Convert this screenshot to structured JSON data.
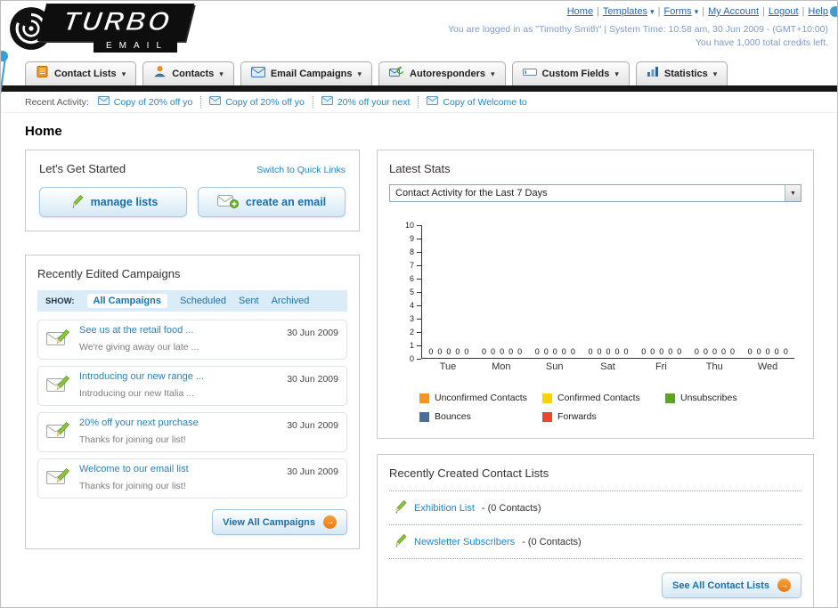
{
  "colors": {
    "accent_blue": "#1C71A8",
    "link_blue": "#2566A8",
    "orange": "#F7941D",
    "dark_bar": "#161616"
  },
  "header": {
    "logo_line1": "TURBO",
    "logo_line2": "EMAIL",
    "top_links": [
      {
        "label": "Home"
      },
      {
        "label": "Templates",
        "arrow": "▾"
      },
      {
        "label": "Forms",
        "arrow": "▾"
      },
      {
        "label": "My Account"
      },
      {
        "label": "Logout"
      },
      {
        "label": "Help"
      }
    ],
    "status_line": "You are logged in as \"Timothy Smith\" | System Time: 10:58 am, 30 Jun 2009 - (GMT+10:00)",
    "credits_line": "You have 1,000 total credits left."
  },
  "main_nav": {
    "arrow": "▾",
    "tabs": [
      {
        "label": "Contact Lists"
      },
      {
        "label": "Contacts"
      },
      {
        "label": "Email Campaigns"
      },
      {
        "label": "Autoresponders"
      },
      {
        "label": "Custom Fields"
      },
      {
        "label": "Statistics"
      }
    ]
  },
  "recent_activity": {
    "label": "Recent Activity:",
    "items": [
      {
        "label": "Copy of 20% off yo"
      },
      {
        "label": "Copy of 20% off yo"
      },
      {
        "label": "20% off your next"
      },
      {
        "label": "Copy of Welcome to"
      }
    ]
  },
  "page_title": "Home",
  "get_started": {
    "title": "Let's Get Started",
    "switch_link": "Switch to Quick Links",
    "manage_lists_label": "manage lists",
    "create_email_label": "create an email"
  },
  "campaigns": {
    "title": "Recently Edited Campaigns",
    "show_label": "SHOW:",
    "filters": [
      {
        "label": "All Campaigns",
        "active": true
      },
      {
        "label": "Scheduled"
      },
      {
        "label": "Sent"
      },
      {
        "label": "Archived"
      }
    ],
    "items": [
      {
        "title": "See us at the retail food ...",
        "subtitle": "We're giving away our late ...",
        "date": "30 Jun 2009"
      },
      {
        "title": "Introducing our new range ...",
        "subtitle": "Introducing our new Italia ...",
        "date": "30 Jun 2009"
      },
      {
        "title": "20% off your next purchase",
        "subtitle": "Thanks for joining our list!",
        "date": "30 Jun 2009"
      },
      {
        "title": "Welcome to our email list",
        "subtitle": "Thanks for joining our list!",
        "date": "30 Jun 2009"
      }
    ],
    "view_all_label": "View All Campaigns"
  },
  "stats": {
    "title": "Latest Stats",
    "dropdown_value": "Contact Activity for the Last 7 Days",
    "chart_data": {
      "type": "bar",
      "title": "Contact Activity for the Last 7 Days",
      "categories": [
        "Tue",
        "Mon",
        "Sun",
        "Sat",
        "Fri",
        "Thu",
        "Wed"
      ],
      "series": [
        {
          "name": "Unconfirmed Contacts",
          "color": "#F7941D",
          "values": [
            0,
            0,
            0,
            0,
            0,
            0,
            0
          ]
        },
        {
          "name": "Confirmed Contacts",
          "color": "#FFD200",
          "values": [
            0,
            0,
            0,
            0,
            0,
            0,
            0
          ]
        },
        {
          "name": "Unsubscribes",
          "color": "#5DA423",
          "values": [
            0,
            0,
            0,
            0,
            0,
            0,
            0
          ]
        },
        {
          "name": "Bounces",
          "color": "#4C6C9C",
          "values": [
            0,
            0,
            0,
            0,
            0,
            0,
            0
          ]
        },
        {
          "name": "Forwards",
          "color": "#E8472B",
          "values": [
            0,
            0,
            0,
            0,
            0,
            0,
            0
          ]
        }
      ],
      "ylim": [
        0,
        10
      ],
      "ytick_step": 1,
      "grid": false,
      "legend_position": "bottom",
      "xlabel": "",
      "ylabel": ""
    }
  },
  "contact_lists": {
    "title": "Recently Created Contact Lists",
    "items": [
      {
        "name": "Exhibition List",
        "suffix": "- (0 Contacts)"
      },
      {
        "name": "Newsletter Subscribers",
        "suffix": "- (0 Contacts)"
      }
    ],
    "see_all_label": "See All Contact Lists"
  }
}
